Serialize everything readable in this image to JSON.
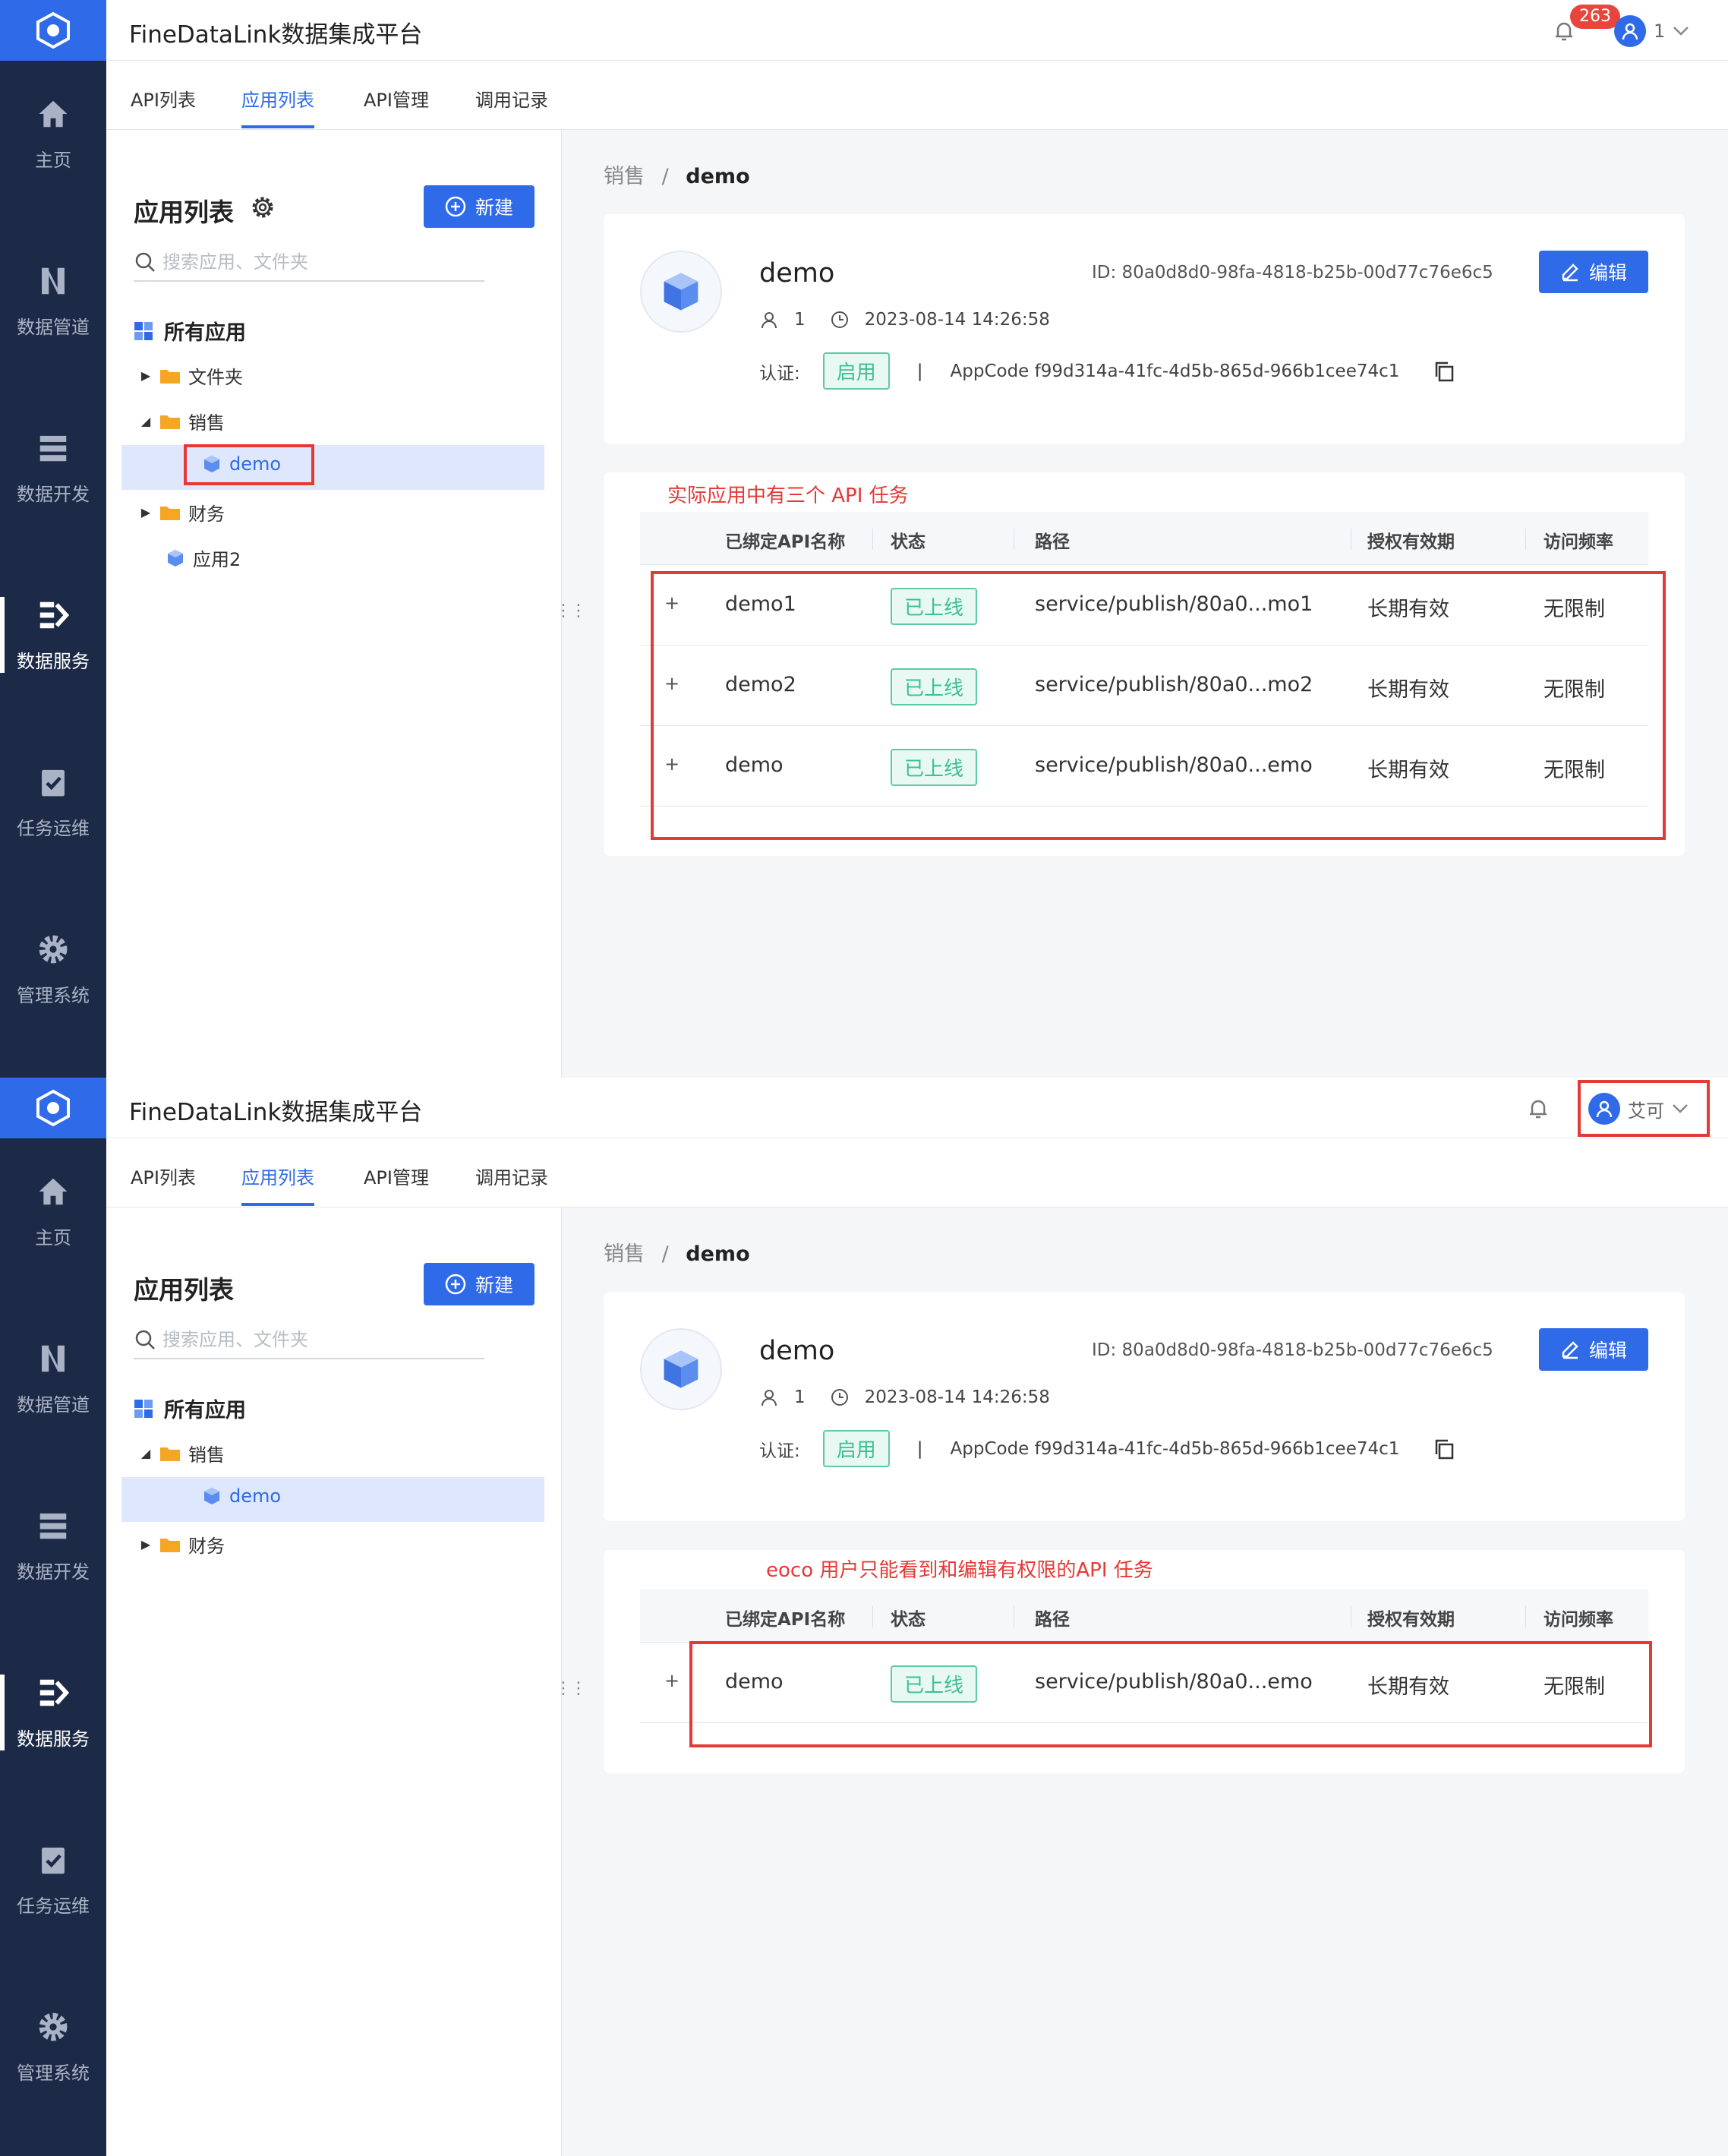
{
  "screens": [
    {
      "header": {
        "title": "FineDataLink数据集成平台",
        "badge": "263",
        "user": "1"
      },
      "nav": [
        "主页",
        "数据管道",
        "数据开发",
        "数据服务",
        "任务运维",
        "管理系统"
      ],
      "tabs": [
        "API列表",
        "应用列表",
        "API管理",
        "调用记录"
      ],
      "panel": {
        "title": "应用列表",
        "new_button": "新建",
        "search_placeholder": "搜索应用、文件夹",
        "all_apps": "所有应用",
        "tree": [
          {
            "label": "文件夹",
            "type": "folder",
            "state": "collapsed"
          },
          {
            "label": "销售",
            "type": "folder",
            "state": "expanded"
          },
          {
            "label": "demo",
            "type": "app",
            "selected": true
          },
          {
            "label": "财务",
            "type": "folder",
            "state": "collapsed"
          },
          {
            "label": "应用2",
            "type": "app"
          }
        ]
      },
      "breadcrumb": {
        "parent": "销售",
        "sep": "/",
        "current": "demo"
      },
      "app": {
        "name": "demo",
        "id": "ID: 80a0d8d0-98fa-4818-b25b-00d77c76e6c5",
        "edit_button": "编辑",
        "owner": "1",
        "created": "2023-08-14 14:26:58",
        "auth_label": "认证:",
        "auth_status": "启用",
        "appcode": "AppCode f99d314a-41fc-4d5b-865d-966b1cee74c1"
      },
      "annotation": "实际应用中有三个 API 任务",
      "table": {
        "headers": [
          "已绑定API名称",
          "状态",
          "路径",
          "授权有效期",
          "访问频率"
        ],
        "rows": [
          {
            "name": "demo1",
            "status": "已上线",
            "path": "service/publish/80a0...mo1",
            "validity": "长期有效",
            "rate": "无限制"
          },
          {
            "name": "demo2",
            "status": "已上线",
            "path": "service/publish/80a0...mo2",
            "validity": "长期有效",
            "rate": "无限制"
          },
          {
            "name": "demo",
            "status": "已上线",
            "path": "service/publish/80a0...emo",
            "validity": "长期有效",
            "rate": "无限制"
          }
        ]
      }
    },
    {
      "header": {
        "title": "FineDataLink数据集成平台",
        "user": "艾可"
      },
      "nav": [
        "主页",
        "数据管道",
        "数据开发",
        "数据服务",
        "任务运维",
        "管理系统"
      ],
      "tabs": [
        "API列表",
        "应用列表",
        "API管理",
        "调用记录"
      ],
      "panel": {
        "title": "应用列表",
        "new_button": "新建",
        "search_placeholder": "搜索应用、文件夹",
        "all_apps": "所有应用",
        "tree": [
          {
            "label": "销售",
            "type": "folder",
            "state": "expanded"
          },
          {
            "label": "demo",
            "type": "app",
            "selected": true
          },
          {
            "label": "财务",
            "type": "folder",
            "state": "collapsed"
          }
        ]
      },
      "breadcrumb": {
        "parent": "销售",
        "sep": "/",
        "current": "demo"
      },
      "app": {
        "name": "demo",
        "id": "ID: 80a0d8d0-98fa-4818-b25b-00d77c76e6c5",
        "edit_button": "编辑",
        "owner": "1",
        "created": "2023-08-14 14:26:58",
        "auth_label": "认证:",
        "auth_status": "启用",
        "appcode": "AppCode f99d314a-41fc-4d5b-865d-966b1cee74c1"
      },
      "annotation": "eoco 用户只能看到和编辑有权限的API 任务",
      "table": {
        "headers": [
          "已绑定API名称",
          "状态",
          "路径",
          "授权有效期",
          "访问频率"
        ],
        "rows": [
          {
            "name": "demo",
            "status": "已上线",
            "path": "service/publish/80a0...emo",
            "validity": "长期有效",
            "rate": "无限制"
          }
        ]
      }
    }
  ],
  "colors": {
    "primary": "#2f6ae8",
    "nav_bg": "#1c2a47",
    "online_tag": "#3bbf94",
    "annotation": "#e53935"
  },
  "icons": [
    "home-icon",
    "pipeline-icon",
    "dev-icon",
    "service-icon",
    "ops-icon",
    "gear-icon",
    "bell-icon",
    "user-icon",
    "search-icon",
    "folder-icon",
    "cube-icon",
    "copy-icon",
    "edit-icon",
    "clock-icon",
    "plus-circle-icon"
  ]
}
